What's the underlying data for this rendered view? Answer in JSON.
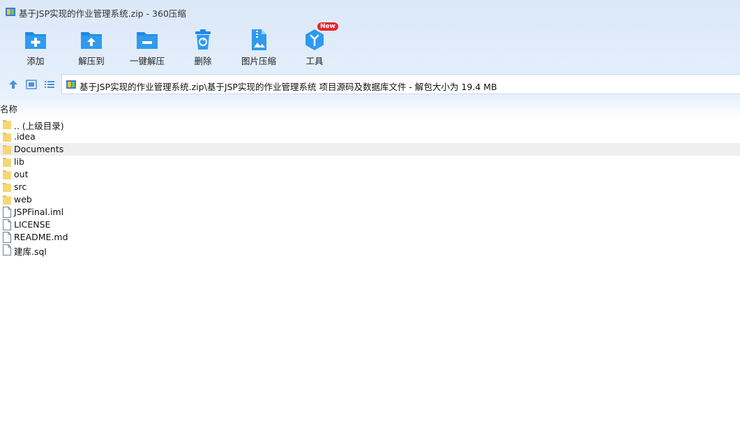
{
  "window": {
    "title": "基于JSP实现的作业管理系统.zip - 360压缩"
  },
  "toolbar": {
    "buttons": [
      {
        "label": "添加",
        "icon": "add-folder-icon"
      },
      {
        "label": "解压到",
        "icon": "extract-to-icon"
      },
      {
        "label": "一键解压",
        "icon": "one-click-extract-icon"
      },
      {
        "label": "删除",
        "icon": "trash-icon"
      },
      {
        "label": "图片压缩",
        "icon": "image-compress-icon"
      },
      {
        "label": "工具",
        "icon": "tools-icon",
        "badge": "New"
      }
    ]
  },
  "nav": {
    "up_icon": "up-arrow-icon",
    "view_icon": "thumbnail-view-icon",
    "list_icon": "list-view-icon"
  },
  "address": {
    "path": "基于JSP实现的作业管理系统.zip\\基于JSP实现的作业管理系统 项目源码及数据库文件 - 解包大小为 19.4 MB"
  },
  "columns": {
    "name": "名称"
  },
  "files": [
    {
      "name": ".. (上级目录)",
      "type": "folder"
    },
    {
      "name": ".idea",
      "type": "folder"
    },
    {
      "name": "Documents",
      "type": "folder",
      "selected": true
    },
    {
      "name": "lib",
      "type": "folder"
    },
    {
      "name": "out",
      "type": "folder"
    },
    {
      "name": "src",
      "type": "folder"
    },
    {
      "name": "web",
      "type": "folder"
    },
    {
      "name": "JSPFinal.iml",
      "type": "file"
    },
    {
      "name": "LICENSE",
      "type": "file"
    },
    {
      "name": "README.md",
      "type": "file"
    },
    {
      "name": "建库.sql",
      "type": "file"
    }
  ],
  "colors": {
    "accent": "#1e8ae6",
    "badge": "#e8262f",
    "folder": "#f7d774",
    "selection": "#efefef"
  }
}
